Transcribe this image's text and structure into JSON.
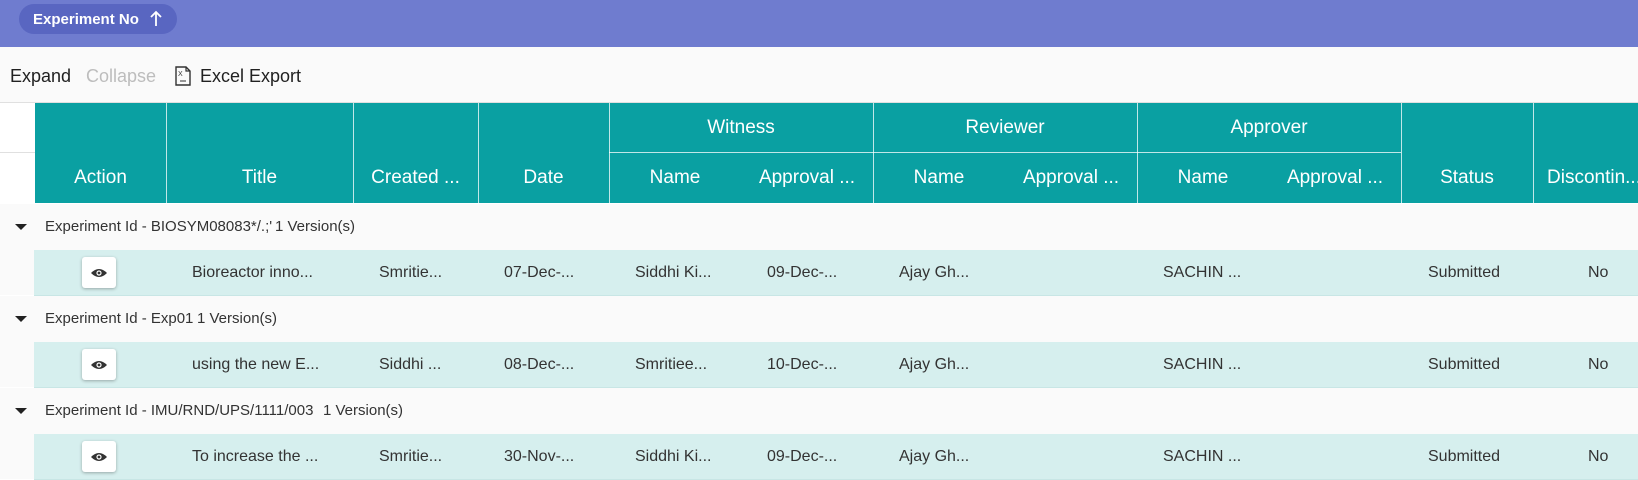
{
  "group_panel": {
    "chip_label": "Experiment No",
    "sort": "ascending"
  },
  "toolbar": {
    "expand": "Expand",
    "collapse": "Collapse",
    "excel_export": "Excel Export"
  },
  "columns": {
    "action": "Action",
    "title": "Title",
    "created": "Created ...",
    "date": "Date",
    "witness": "Witness",
    "reviewer": "Reviewer",
    "approver": "Approver",
    "name": "Name",
    "approval": "Approval ...",
    "status": "Status",
    "discontinued": "Discontin..."
  },
  "groups": [
    {
      "label": "Experiment Id - BIOSYM08083*/.;'",
      "count": "1 Version(s)",
      "row": {
        "title": "Bioreactor inno...",
        "created_by": "Smritie...",
        "date": "07-Dec-...",
        "witness_name": "Siddhi Ki...",
        "witness_approval": "09-Dec-...",
        "reviewer_name": "Ajay Gh...",
        "reviewer_approval": "",
        "approver_name": "SACHIN ...",
        "approver_approval": "",
        "status": "Submitted",
        "discontinued": "No"
      }
    },
    {
      "label": "Experiment Id - Exp01",
      "count": "1 Version(s)",
      "row": {
        "title": "using the new E...",
        "created_by": "Siddhi ...",
        "date": "08-Dec-...",
        "witness_name": "Smritiee...",
        "witness_approval": "10-Dec-...",
        "reviewer_name": "Ajay Gh...",
        "reviewer_approval": "",
        "approver_name": "SACHIN ...",
        "approver_approval": "",
        "status": "Submitted",
        "discontinued": "No"
      }
    },
    {
      "label": "Experiment Id - IMU/RND/UPS/1111/003",
      "count": "1 Version(s)",
      "row": {
        "title": "To increase the ...",
        "created_by": "Smritie...",
        "date": "30-Nov-...",
        "witness_name": "Siddhi Ki...",
        "witness_approval": "09-Dec-...",
        "reviewer_name": "Ajay Gh...",
        "reviewer_approval": "",
        "approver_name": "SACHIN ...",
        "approver_approval": "",
        "status": "Submitted",
        "discontinued": "No"
      }
    }
  ],
  "colors": {
    "header_bg": "#0aa0a2",
    "group_bar": "#6f7ccf",
    "chip": "#5966c1",
    "row_bg": "#d6efee"
  },
  "icons": {
    "sort": "arrow-up-icon",
    "export": "excel-file-icon",
    "expand_group": "caret-down-icon",
    "view": "eye-icon"
  }
}
